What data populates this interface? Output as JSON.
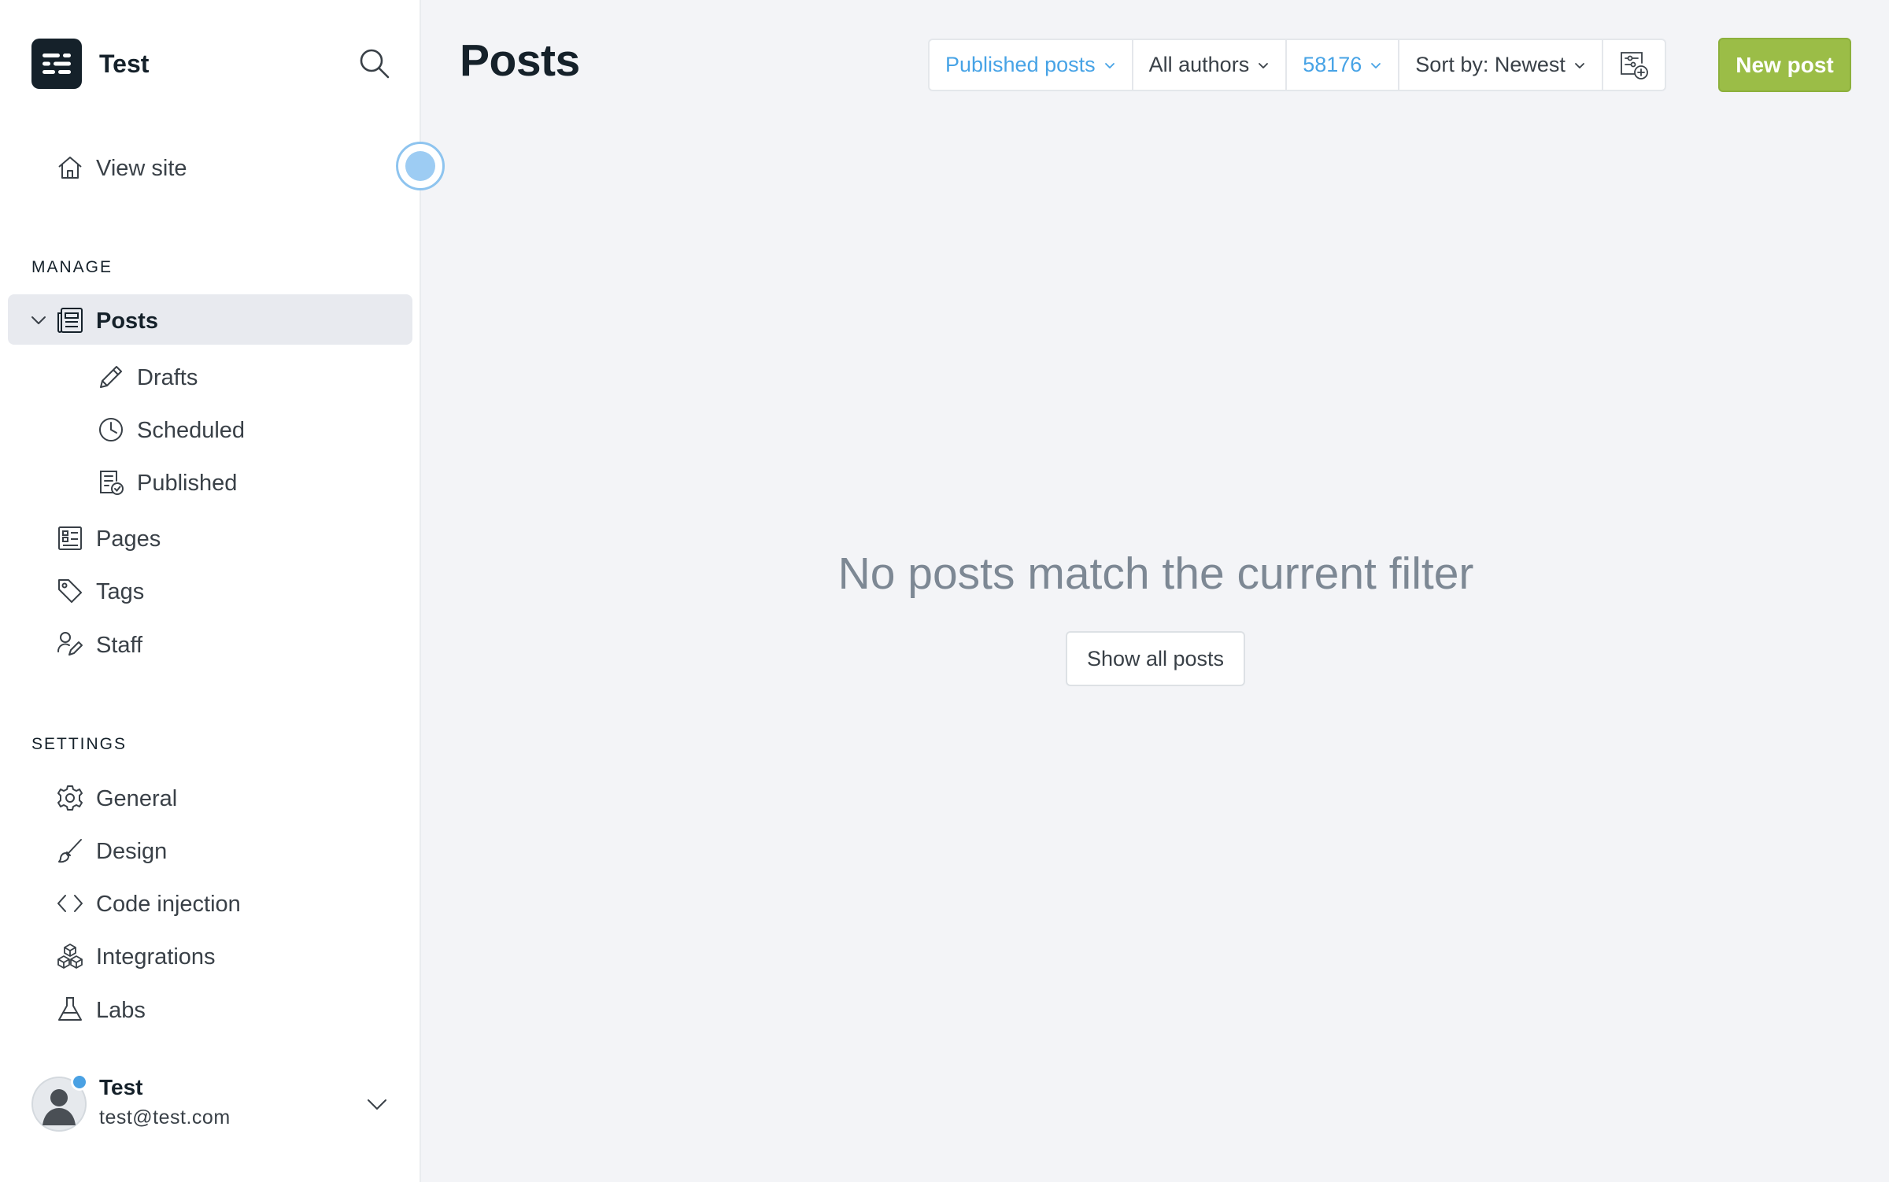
{
  "brand": {
    "name": "Test",
    "logo_icon": "ghost-logo-icon"
  },
  "nav": {
    "view_site": "View site",
    "manage_label": "MANAGE",
    "posts": "Posts",
    "drafts": "Drafts",
    "scheduled": "Scheduled",
    "published": "Published",
    "pages": "Pages",
    "tags": "Tags",
    "staff": "Staff",
    "settings_label": "SETTINGS",
    "general": "General",
    "design": "Design",
    "code_injection": "Code injection",
    "integrations": "Integrations",
    "labs": "Labs"
  },
  "user": {
    "name": "Test",
    "email": "test@test.com"
  },
  "header": {
    "title": "Posts",
    "filter_type": "Published posts",
    "filter_author": "All authors",
    "filter_tag": "58176",
    "sort": "Sort by: Newest",
    "new_post": "New post"
  },
  "empty": {
    "message": "No posts match the current filter",
    "show_all": "Show all posts"
  },
  "colors": {
    "accent_blue": "#47a3e6",
    "new_post_green": "#9bbd47",
    "sidebar_active": "#e8eaef"
  }
}
